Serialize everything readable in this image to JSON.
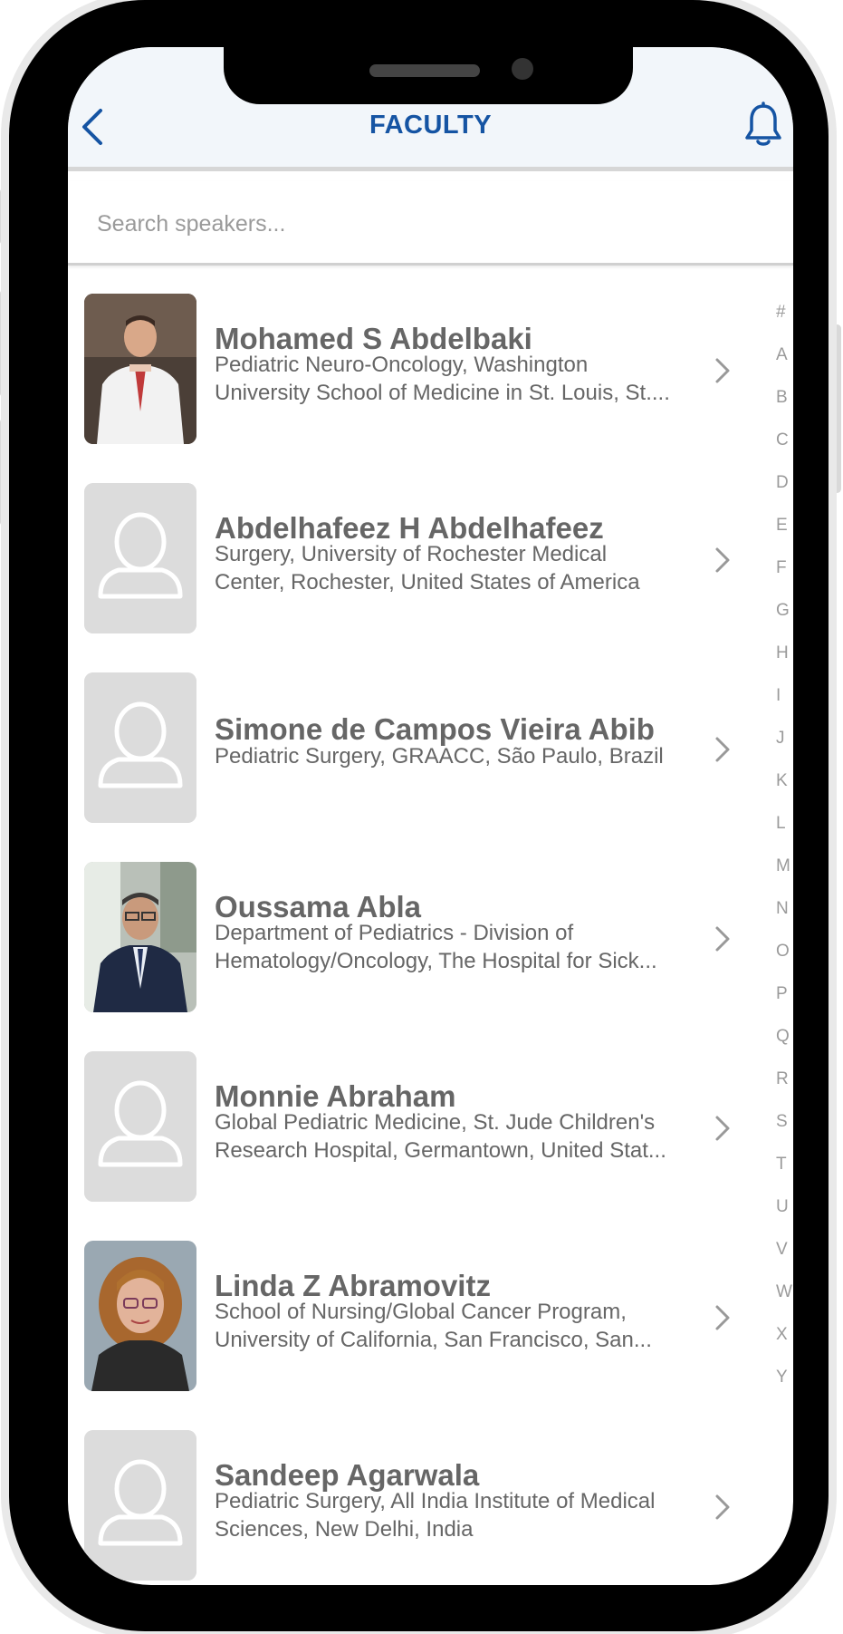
{
  "header": {
    "title": "FACULTY"
  },
  "search": {
    "placeholder": "Search speakers..."
  },
  "speakers": [
    {
      "name": "Mohamed S Abdelbaki",
      "desc1": "Pediatric Neuro-Oncology, Washington",
      "desc2": "University School of Medicine in St. Louis, St....",
      "photo": "photo"
    },
    {
      "name": "Abdelhafeez H Abdelhafeez",
      "desc1": "Surgery, University of Rochester Medical",
      "desc2": "Center, Rochester, United States of America",
      "photo": "placeholder"
    },
    {
      "name": "Simone de Campos Vieira Abib",
      "desc1": "Pediatric Surgery, GRAACC, São Paulo, Brazil",
      "desc2": "",
      "photo": "placeholder"
    },
    {
      "name": "Oussama Abla",
      "desc1": "Department of Pediatrics - Division of",
      "desc2": "Hematology/Oncology, The Hospital for Sick...",
      "photo": "photo"
    },
    {
      "name": "Monnie Abraham",
      "desc1": "Global Pediatric Medicine, St. Jude Children's",
      "desc2": "Research Hospital, Germantown, United Stat...",
      "photo": "placeholder"
    },
    {
      "name": "Linda Z Abramovitz",
      "desc1": "School of Nursing/Global Cancer Program,",
      "desc2": "University of California, San Francisco, San...",
      "photo": "photo"
    },
    {
      "name": "Sandeep Agarwala",
      "desc1": "Pediatric Surgery, All India Institute of Medical",
      "desc2": "Sciences, New Delhi, India",
      "photo": "placeholder"
    }
  ],
  "index_letters": [
    "#",
    "A",
    "B",
    "C",
    "D",
    "E",
    "F",
    "G",
    "H",
    "I",
    "J",
    "K",
    "L",
    "M",
    "N",
    "O",
    "P",
    "Q",
    "R",
    "S",
    "T",
    "U",
    "V",
    "W",
    "X",
    "Y"
  ],
  "colors": {
    "accent": "#1554a3",
    "header_bg": "#f2f6fa",
    "text": "#666666",
    "placeholder_avatar": "#dcdcdc"
  }
}
